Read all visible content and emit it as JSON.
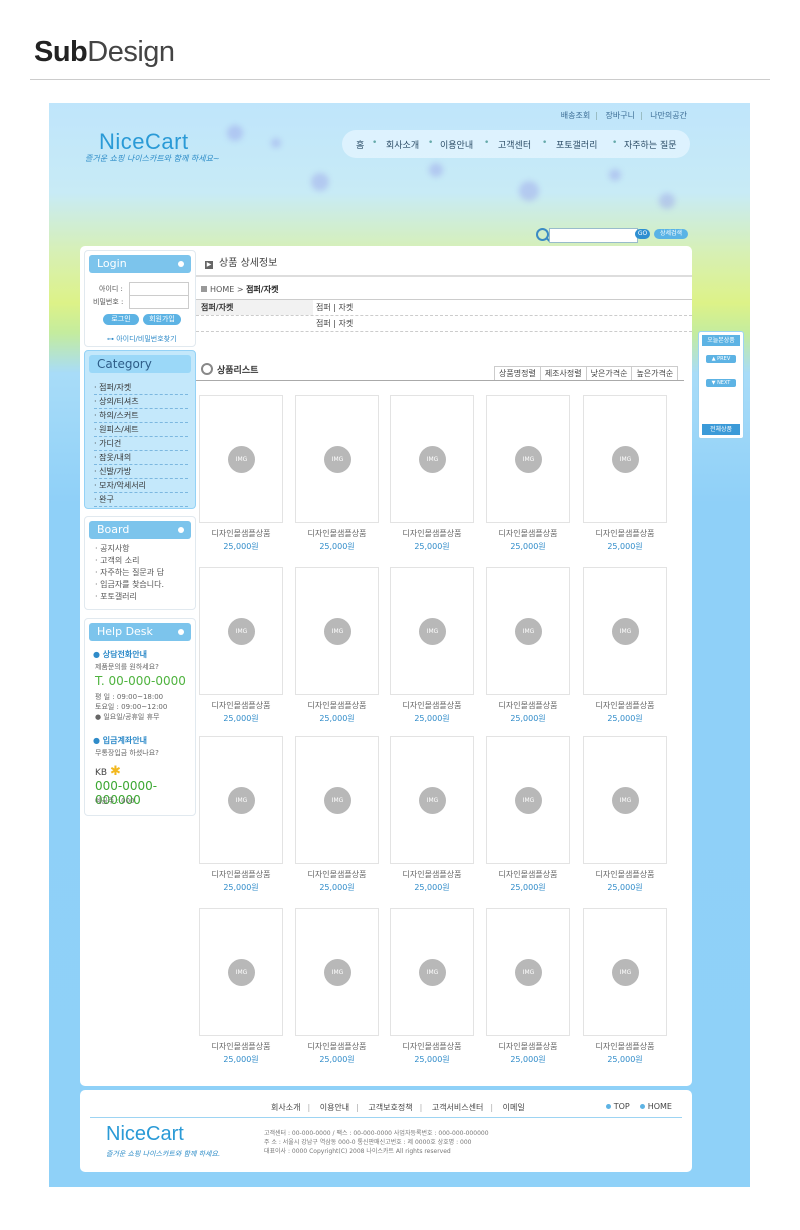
{
  "page_header": {
    "title_bold": "Sub",
    "title_normal": "Design"
  },
  "top_links": [
    "배송조회",
    "장바구니",
    "나만의공간"
  ],
  "logo": {
    "text": "NiceCart",
    "tagline": "즐거운 쇼핑 나이스카트와 함께 하세요~"
  },
  "gnb": [
    "홈",
    "회사소개",
    "이용안내",
    "고객센터",
    "포토갤러리",
    "자주하는 질문"
  ],
  "search": {
    "placeholder": "",
    "go_label": "GO",
    "advanced_label": "상세검색"
  },
  "login": {
    "title": "Login",
    "id_label": "아이디 :",
    "pw_label": "비밀번호 :",
    "login_btn": "로그인",
    "join_btn": "회원가입",
    "find_link": "아이디/비밀번호찾기"
  },
  "category": {
    "title": "Category",
    "items": [
      "점퍼/자켓",
      "상의/티셔츠",
      "하의/스커트",
      "원피스/세트",
      "가디건",
      "잠옷/내의",
      "신발/가방",
      "모자/악세서리",
      "완구"
    ]
  },
  "board": {
    "title": "Board",
    "items": [
      "공지사항",
      "고객의 소리",
      "자주하는 질문과 답",
      "입금자를 찾습니다.",
      "포토갤러리"
    ]
  },
  "helpdesk": {
    "title": "Help Desk",
    "phone_title": "상담전화안내",
    "phone_sub": "제품문의를 원하세요?",
    "phone": "T. 00-000-0000",
    "hours_weekday": "평    일 : 09:00~18:00",
    "hours_sat": "토요일 : 09:00~12:00",
    "holiday": "일요일/공휴일 휴무",
    "bank_title": "입금계좌안내",
    "bank_sub": "무통장입금 하셨나요?",
    "bank_name": "KB",
    "account": "000-0000-000000",
    "holder": "예금주 : 000"
  },
  "content": {
    "section_title": "상품 상세정보",
    "breadcrumb_home": "HOME >",
    "breadcrumb_current": "점퍼/자켓",
    "cat_key": "점퍼/자켓",
    "cat_rows": [
      "점퍼 | 자켓",
      "점퍼 | 자켓"
    ],
    "list_title": "상품리스트",
    "sort_options": [
      "상품명정렬",
      "제조사정렬",
      "낮은가격순",
      "높은가격순"
    ],
    "product_name": "디자인몰샘플상품",
    "product_price": "25,000원",
    "img_label": "IMG"
  },
  "recent": {
    "title": "오늘본상품",
    "prev": "PREV",
    "next": "NEXT",
    "all": "전체상품"
  },
  "footer": {
    "links": [
      "회사소개",
      "이용안내",
      "고객보호정책",
      "고객서비스센터",
      "이메일"
    ],
    "top": "TOP",
    "home": "HOME",
    "logo": "NiceCart",
    "tagline": "즐거운 쇼핑 나이스카트와 함께 하세요.",
    "info1": "고객센터 : 00-000-0000 / 팩스 : 00-000-0000     사업자등록번호 : 000-000-000000",
    "info2": "주 소 : 서울시 강남구 역삼동 000-0     통신판매신고번호 : 제 0000호     상호명 : 000",
    "info3": "대표이사 : 0000 Copyright(C) 2008 나이스카트 All rights reserved"
  },
  "colors": {
    "accent": "#5db3e4",
    "brand": "#2a9ad6",
    "phone": "#4fb33f"
  }
}
